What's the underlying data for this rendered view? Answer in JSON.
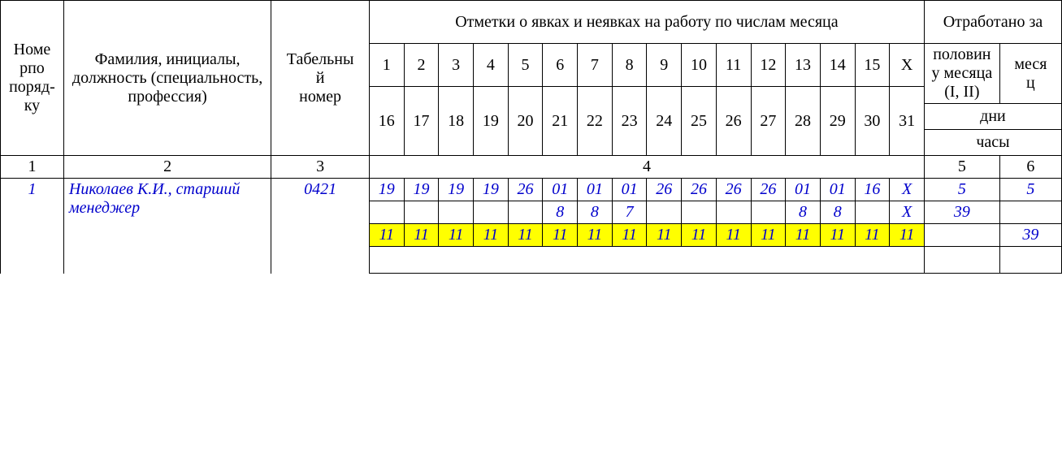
{
  "headers": {
    "order_no": "Номе\nрпо поряд-ку",
    "full_name": "Фамилия, инициалы, должность (специальность, профессия)",
    "tab_no": "Табельный номер",
    "marks_title": "Отметки о явках и неявках на работу по числам месяца",
    "worked_title": "Отработано за",
    "half_month": "половину месяца (I, II)",
    "month": "месяц",
    "days_label": "дни",
    "hours_label": "часы",
    "days_r1": [
      "1",
      "2",
      "3",
      "4",
      "5",
      "6",
      "7",
      "8",
      "9",
      "10",
      "11",
      "12",
      "13",
      "14",
      "15",
      "X"
    ],
    "days_r2": [
      "16",
      "17",
      "18",
      "19",
      "20",
      "21",
      "22",
      "23",
      "24",
      "25",
      "26",
      "27",
      "28",
      "29",
      "30",
      "31"
    ],
    "col_nums": {
      "c1": "1",
      "c2": "2",
      "c3": "3",
      "c4": "4",
      "c5": "5",
      "c6": "6"
    }
  },
  "row": {
    "no": "1",
    "name": "Николаев К.И., старший менеджер",
    "tab": "0421",
    "r1": [
      "19",
      "19",
      "19",
      "19",
      "26",
      "01",
      "01",
      "01",
      "26",
      "26",
      "26",
      "26",
      "01",
      "01",
      "16",
      "X"
    ],
    "r2": [
      "",
      "",
      "",
      "",
      "",
      "8",
      "8",
      "7",
      "",
      "",
      "",
      "",
      "8",
      "8",
      "",
      "X"
    ],
    "r3": [
      "11",
      "11",
      "11",
      "11",
      "11",
      "11",
      "11",
      "11",
      "11",
      "11",
      "11",
      "11",
      "11",
      "11",
      "11",
      "11"
    ],
    "half_r1": "5",
    "month_r1": "5",
    "half_r2": "39",
    "month_r2": "",
    "half_r3": "",
    "month_r3": "39"
  },
  "chart_data": {
    "type": "table",
    "title": "Timesheet fragment (T-12 style)",
    "employee": "Николаев К.И., старший менеджер",
    "personnel_no": "0421",
    "order_no": 1,
    "first_half_days": {
      "1": "19",
      "2": "19",
      "3": "19",
      "4": "19",
      "5": "26",
      "6": "01",
      "7": "01",
      "8": "01",
      "9": "26",
      "10": "26",
      "11": "26",
      "12": "26",
      "13": "01",
      "14": "01",
      "15": "16",
      "X": "X"
    },
    "first_half_hours": {
      "1": "",
      "2": "",
      "3": "",
      "4": "",
      "5": "",
      "6": "8",
      "7": "8",
      "8": "7",
      "9": "",
      "10": "",
      "11": "",
      "12": "",
      "13": "8",
      "14": "8",
      "15": "",
      "X": "X"
    },
    "second_half_days": {
      "16": "11",
      "17": "11",
      "18": "11",
      "19": "11",
      "20": "11",
      "21": "11",
      "22": "11",
      "23": "11",
      "24": "11",
      "25": "11",
      "26": "11",
      "27": "11",
      "28": "11",
      "29": "11",
      "30": "11",
      "31": "11"
    },
    "totals": {
      "half_month_days": 5,
      "month_days": 5,
      "half_month_hours": 39,
      "month_hours": 39
    }
  }
}
